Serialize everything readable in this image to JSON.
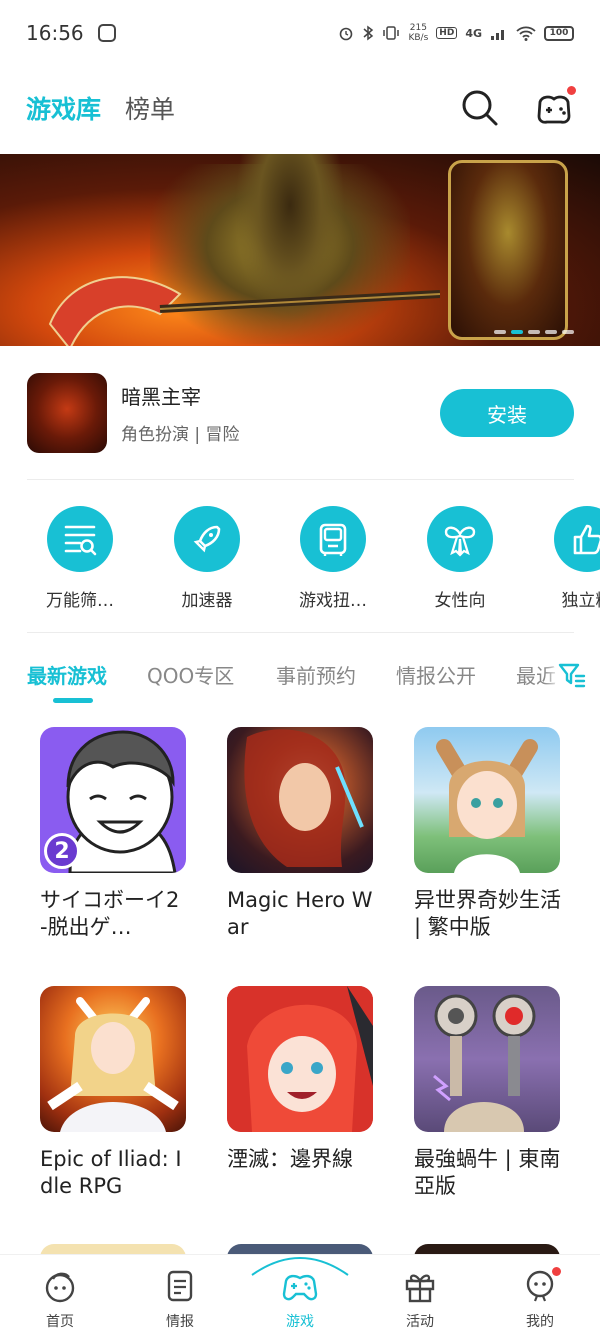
{
  "status_bar": {
    "time": "16:56",
    "net_speed_value": "215",
    "net_speed_unit": "KB/s",
    "hd": "HD",
    "network": "4G",
    "battery": "100"
  },
  "header": {
    "tab_active": "游戏库",
    "tab_other": "榜单"
  },
  "featured": {
    "name": "暗黑主宰",
    "tags": "角色扮演 | 冒险",
    "install_label": "安装"
  },
  "categories": [
    {
      "label": "万能筛…",
      "icon": "filter-list-icon"
    },
    {
      "label": "加速器",
      "icon": "rocket-icon"
    },
    {
      "label": "游戏扭…",
      "icon": "gacha-machine-icon"
    },
    {
      "label": "女性向",
      "icon": "ribbon-icon"
    },
    {
      "label": "独立精",
      "icon": "thumbs-up-icon"
    }
  ],
  "subtabs": [
    "最新游戏",
    "QOO专区",
    "事前预约",
    "情报公开",
    "最近"
  ],
  "games": [
    {
      "title": "サイコボーイ2 -脱出ゲ…",
      "badge": "2"
    },
    {
      "title": "Magic Hero War"
    },
    {
      "title": "异世界奇妙生活 | 繁中版"
    },
    {
      "title": "Epic of Iliad: Idle RPG"
    },
    {
      "title": "湮滅：邊界線"
    },
    {
      "title": "最強蝸牛 | 東南亞版"
    }
  ],
  "bottom_nav": [
    {
      "label": "首页",
      "icon": "home-mascot-icon"
    },
    {
      "label": "情报",
      "icon": "news-icon"
    },
    {
      "label": "游戏",
      "icon": "gamepad-icon"
    },
    {
      "label": "活动",
      "icon": "gift-icon"
    },
    {
      "label": "我的",
      "icon": "profile-icon"
    }
  ],
  "colors": {
    "accent": "#18c0d4",
    "notification": "#f04040"
  }
}
